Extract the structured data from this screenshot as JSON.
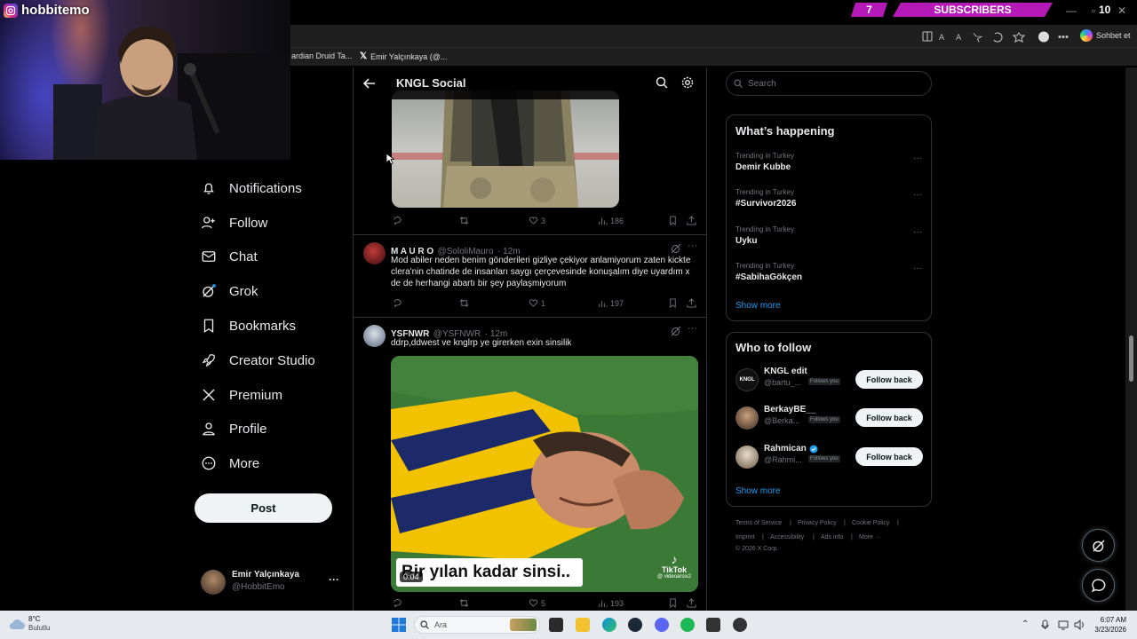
{
  "stream": {
    "username": "hobbitemo",
    "subscriber_count": "7",
    "subscriber_label": "SUBSCRIBERS",
    "counter": "10"
  },
  "browser": {
    "copilot_label": "Sohbet et",
    "bookmarks": [
      {
        "label": "ardian Druid Ta..."
      },
      {
        "label": "Emir Yalçınkaya (@..."
      }
    ]
  },
  "nav": {
    "items": [
      {
        "label": "Notifications",
        "icon": "bell-icon"
      },
      {
        "label": "Follow",
        "icon": "person-add-icon"
      },
      {
        "label": "Chat",
        "icon": "envelope-icon"
      },
      {
        "label": "Grok",
        "icon": "grok-icon"
      },
      {
        "label": "Bookmarks",
        "icon": "bookmark-icon"
      },
      {
        "label": "Creator Studio",
        "icon": "rocket-icon"
      },
      {
        "label": "Premium",
        "icon": "x-logo-icon"
      },
      {
        "label": "Profile",
        "icon": "person-icon"
      },
      {
        "label": "More",
        "icon": "more-circle-icon"
      }
    ],
    "post_label": "Post",
    "account": {
      "name": "Emir Yalçınkaya",
      "handle": "@HobbitEmo",
      "more": "···"
    }
  },
  "timeline": {
    "title": "KNGL Social",
    "tweet0_actions": {
      "replies": "",
      "reposts": "",
      "likes": "3",
      "views": "186"
    },
    "tweets": [
      {
        "name": "M A U R O",
        "handle": "@SololiMauro",
        "time": "· 12m",
        "text": "Mod abiler neden benim gönderileri gizliye çekiyor anlamiyorum zaten kickte clera'nin chatinde de insanları saygı çerçevesinde konuşalım diye uyardım x de de herhangi abartı bir şey paylaşmiyorum",
        "likes": "1",
        "views": "197"
      },
      {
        "name": "YSFNWR",
        "handle": "@YSFNWR",
        "time": "· 12m",
        "text": "ddrp,ddwest ve knglrp ye girerken exin sinsilik",
        "video_caption": "Bir yılan kadar sinsi..",
        "video_duration": "0:04",
        "watermark_brand": "TikTok",
        "watermark_handle": "@ videoarsiv2",
        "likes": "5",
        "views": "193"
      }
    ]
  },
  "sidebar": {
    "search_placeholder": "Search",
    "happening_title": "What’s happening",
    "trends": [
      {
        "category": "Trending in Turkey",
        "name": "Demir Kubbe"
      },
      {
        "category": "Trending in Turkey",
        "name": "#Survivor2026"
      },
      {
        "category": "Trending in Turkey",
        "name": "Uyku"
      },
      {
        "category": "Trending in Turkey",
        "name": "#SabihaGökçen"
      }
    ],
    "show_more": "Show more",
    "who_title": "Who to follow",
    "follow": [
      {
        "name": "KNGL edit",
        "handle": "@bartu_...",
        "badge": "Follows you",
        "button": "Follow back",
        "verified": false
      },
      {
        "name": "BerkayBE__",
        "handle": "@Berka...",
        "badge": "Follows you",
        "button": "Follow back",
        "verified": false
      },
      {
        "name": "Rahmican",
        "handle": "@Rahmi...",
        "badge": "Follows you",
        "button": "Follow back",
        "verified": true
      }
    ],
    "footer": {
      "terms": "Terms of Service",
      "privacy": "Privacy Policy",
      "cookie": "Cookie Policy",
      "imprint": "Imprint",
      "accessibility": "Accessibility",
      "ads": "Ads info",
      "more": "More ···",
      "copyright": "© 2026 X Corp."
    }
  },
  "taskbar": {
    "weather_temp": "8°C",
    "weather_desc": "Bulutlu",
    "search_placeholder": "Ara",
    "time": "6:07 AM",
    "date": "3/23/2026"
  },
  "colors": {
    "accent": "#1d9bf0",
    "subscriber_banner": "#b51ab8",
    "taskbar": "#e6e9ee",
    "border": "#2f3336"
  }
}
